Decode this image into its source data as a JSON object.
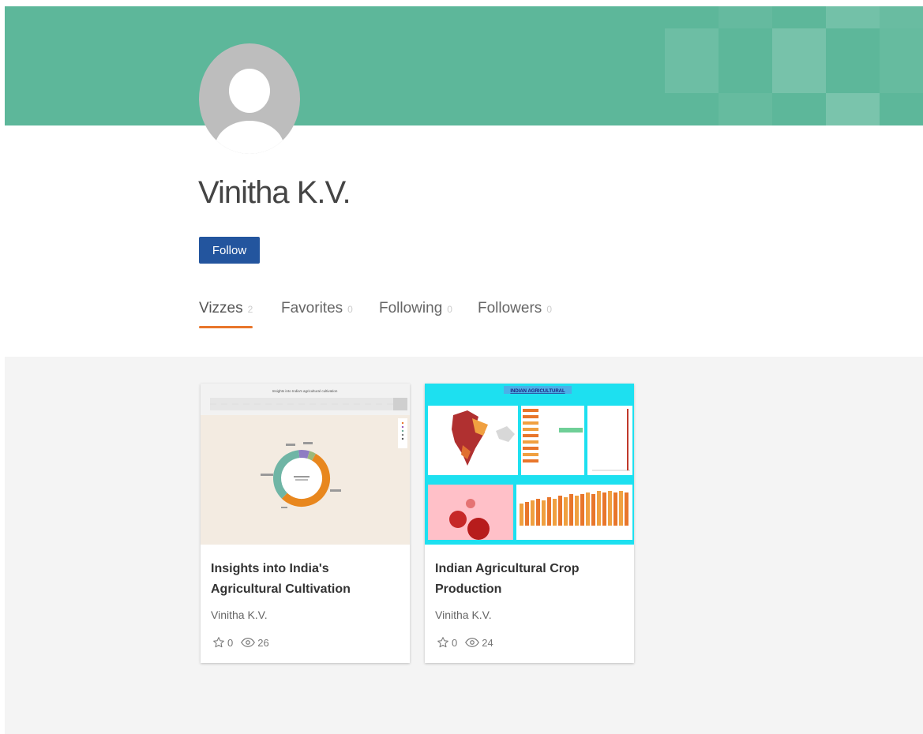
{
  "profile": {
    "name": "Vinitha K.V.",
    "follow_label": "Follow"
  },
  "tabs": [
    {
      "label": "Vizzes",
      "count": "2",
      "active": true
    },
    {
      "label": "Favorites",
      "count": "0"
    },
    {
      "label": "Following",
      "count": "0"
    },
    {
      "label": "Followers",
      "count": "0"
    }
  ],
  "vizzes": [
    {
      "title": "Insights into India's Agricultural Cultivation",
      "author": "Vinitha K.V.",
      "favorites": "0",
      "views": "26",
      "thumbnail_title": "Insights into India's agricultural cultivation"
    },
    {
      "title": "Indian Agricultural Crop Production",
      "author": "Vinitha K.V.",
      "favorites": "0",
      "views": "24",
      "thumbnail_title": "INDIAN AGRICULTURAL"
    }
  ],
  "colors": {
    "banner": "#5db79a",
    "follow_button": "#23559e",
    "active_tab_underline": "#e8762b",
    "gallery_background": "#f4f4f4"
  },
  "icons": {
    "favorite": "star-icon",
    "views": "eye-icon"
  }
}
